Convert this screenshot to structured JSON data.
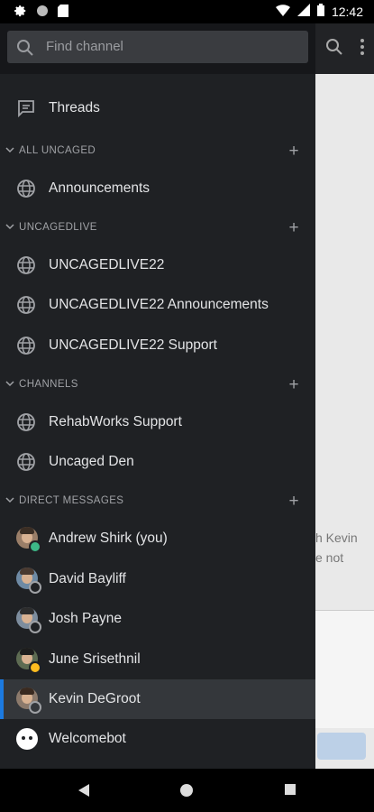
{
  "status_bar": {
    "time": "12:42"
  },
  "drawer": {
    "search_placeholder": "Find channel",
    "threads_label": "Threads",
    "sections": [
      {
        "title": "ALL UNCAGED",
        "channels": [
          "Announcements"
        ]
      },
      {
        "title": "UNCAGEDLIVE",
        "channels": [
          "UNCAGEDLIVE22",
          "UNCAGEDLIVE22 Announcements",
          "UNCAGEDLIVE22 Support"
        ]
      },
      {
        "title": "CHANNELS",
        "channels": [
          "RehabWorks Support",
          "Uncaged Den"
        ]
      },
      {
        "title": "DIRECT MESSAGES"
      }
    ],
    "direct_messages": [
      {
        "name": "Andrew Shirk (you)",
        "status": "online"
      },
      {
        "name": "David Bayliff",
        "status": "offline"
      },
      {
        "name": "Josh Payne",
        "status": "offline"
      },
      {
        "name": "June Srisethnil",
        "status": "away"
      },
      {
        "name": "Kevin DeGroot",
        "status": "offline",
        "active": true
      },
      {
        "name": "Welcomebot",
        "status": "bot"
      }
    ]
  },
  "background": {
    "message_fragment": [
      "h Kevin",
      "e not"
    ]
  },
  "colors": {
    "drawer_bg": "#1f2124",
    "accent": "#1c7ae0",
    "online": "#3db887",
    "away": "#ffbc1f"
  }
}
